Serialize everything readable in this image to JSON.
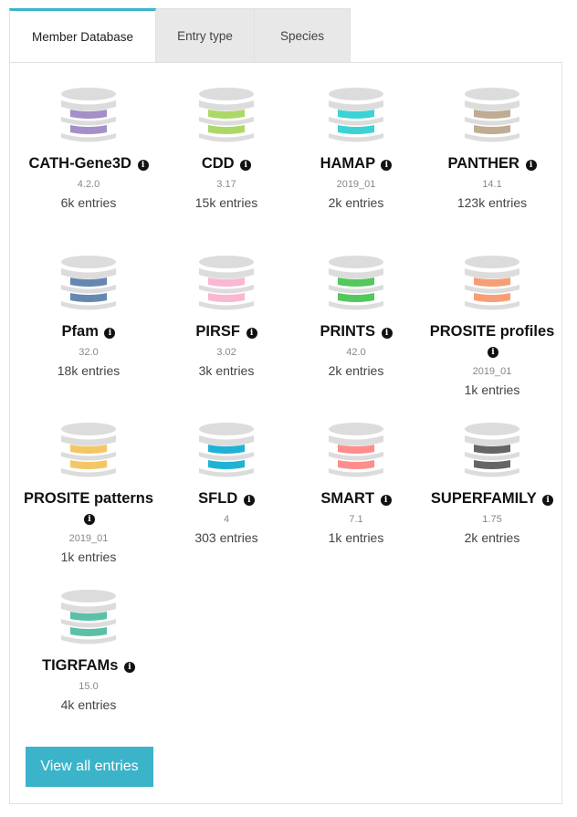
{
  "tabs": [
    {
      "label": "Member Database",
      "active": true
    },
    {
      "label": "Entry type",
      "active": false
    },
    {
      "label": "Species",
      "active": false
    }
  ],
  "databases": [
    {
      "name": "CATH-Gene3D",
      "version": "4.2.0",
      "entries": "6k entries",
      "color": "#a58fc8"
    },
    {
      "name": "CDD",
      "version": "3.17",
      "entries": "15k entries",
      "color": "#add868"
    },
    {
      "name": "HAMAP",
      "version": "2019_01",
      "entries": "2k entries",
      "color": "#3dd3d6"
    },
    {
      "name": "PANTHER",
      "version": "14.1",
      "entries": "123k entries",
      "color": "#bfac92"
    },
    {
      "name": "Pfam",
      "version": "32.0",
      "entries": "18k entries",
      "color": "#6688b0"
    },
    {
      "name": "PIRSF",
      "version": "3.02",
      "entries": "3k entries",
      "color": "#f9b7d2"
    },
    {
      "name": "PRINTS",
      "version": "42.0",
      "entries": "2k entries",
      "color": "#54c75f"
    },
    {
      "name": "PROSITE profiles",
      "version": "2019_01",
      "entries": "1k entries",
      "color": "#f69f74"
    },
    {
      "name": "PROSITE patterns",
      "version": "2019_01",
      "entries": "1k entries",
      "color": "#f3c766"
    },
    {
      "name": "SFLD",
      "version": "4",
      "entries": "303 entries",
      "color": "#20b2d4"
    },
    {
      "name": "SMART",
      "version": "7.1",
      "entries": "1k entries",
      "color": "#ff8d8d"
    },
    {
      "name": "SUPERFAMILY",
      "version": "1.75",
      "entries": "2k entries",
      "color": "#656565"
    },
    {
      "name": "TIGRFAMs",
      "version": "15.0",
      "entries": "4k entries",
      "color": "#5bc0a6"
    }
  ],
  "info_icon": "info-circle-icon",
  "view_all_label": "View all entries",
  "accent_color": "#3bb3c8"
}
